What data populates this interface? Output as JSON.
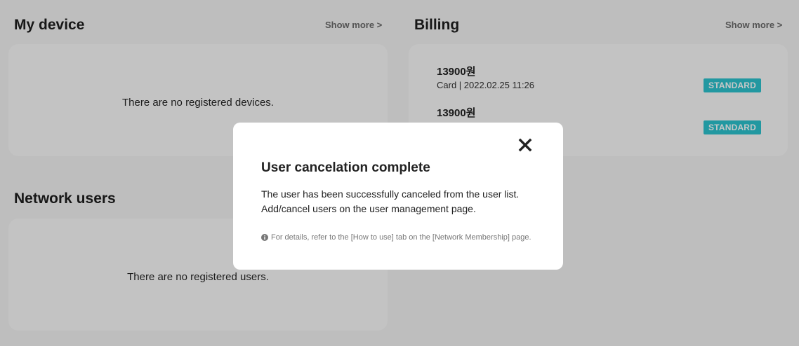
{
  "device": {
    "title": "My device",
    "show_more": "Show more >",
    "empty": "There are no registered devices."
  },
  "billing": {
    "title": "Billing",
    "show_more": "Show more >",
    "items": [
      {
        "amount": "13900원",
        "meta": "Card | 2022.02.25 11:26",
        "plan": "STANDARD"
      },
      {
        "amount": "13900원",
        "meta": "",
        "plan": "STANDARD"
      }
    ]
  },
  "network": {
    "title": "Network users",
    "empty": "There are no registered users."
  },
  "modal": {
    "title": "User cancelation complete",
    "line1": "The user has been successfully canceled from the user list.",
    "line2": "Add/cancel users on the user management page.",
    "note": "For details, refer to the [How to use] tab on the [Network Membership] page.",
    "close_icon": "close-icon",
    "info_icon": "info-icon"
  },
  "colors": {
    "badge": "#2cc3cf",
    "backdrop": "#c4c4c4",
    "modal_bg": "#ffffff"
  }
}
